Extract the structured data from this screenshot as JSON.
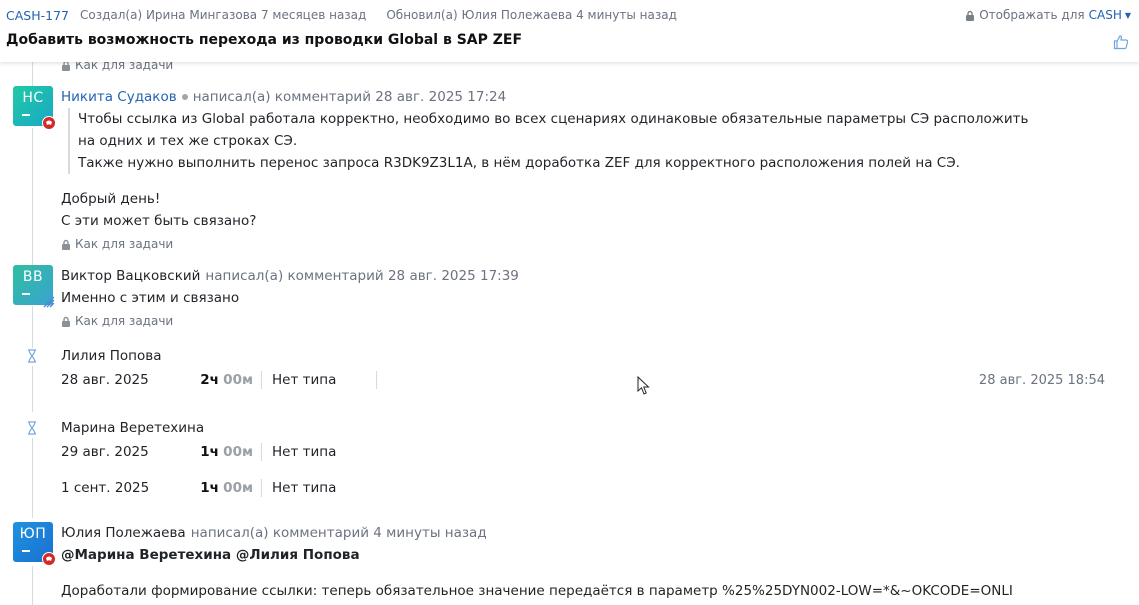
{
  "header": {
    "task_key": "CASH-177",
    "created": "Создал(а) Ирина Мингазова 7 месяцев назад",
    "updated": "Обновил(а) Юлия Полежаева 4 минуты назад",
    "visibility_label": "Отображать для",
    "visibility_project": "CASH",
    "title": "Добавить возможность перехода из проводки Global в SAP ZEF"
  },
  "permission_label": "Как для задачи",
  "comments": [
    {
      "initials": "НС",
      "author": "Никита Судаков",
      "action": "написал(а) комментарий 28 авг. 2025 17:24",
      "quote": [
        "Чтобы ссылка из Global работала корректно, необходимо во всех сценариях одинаковые обязательные параметры СЭ расположить",
        "на одних и тех же строках СЭ.",
        "Также нужно выполнить перенос запроса R3DK9Z3L1A, в нём доработка ZEF для корректного расположения полей на СЭ."
      ],
      "body": [
        "Добрый день!",
        "С эти может быть связано?"
      ]
    },
    {
      "initials": "ВВ",
      "author": "Виктор Вацковский",
      "action": "написал(а) комментарий 28 авг. 2025 17:39",
      "body": [
        "Именно с этим и связано"
      ]
    },
    {
      "initials": "ЮП",
      "author": "Юлия Полежаева",
      "action": "написал(а) комментарий 4 минуты назад",
      "mentions": "@Марина Веретехина @Лилия Попова",
      "body": [
        "Доработали формирование ссылки: теперь обязательное значение передаётся в параметр %25%25DYN002-LOW=*&~OKCODE=ONLI"
      ]
    }
  ],
  "worklogs": [
    {
      "user": "Лилия Попова",
      "entries": [
        {
          "date": "28 авг. 2025",
          "hours": "2ч",
          "minutes": "00м",
          "type": "Нет типа",
          "stamp": "28 авг. 2025 18:54"
        }
      ]
    },
    {
      "user": "Марина Веретехина",
      "entries": [
        {
          "date": "29 авг. 2025",
          "hours": "1ч",
          "minutes": "00м",
          "type": "Нет типа"
        },
        {
          "date": "1 сент. 2025",
          "hours": "1ч",
          "minutes": "00м",
          "type": "Нет типа"
        }
      ]
    }
  ],
  "icons": [
    "lock-icon",
    "like-icon",
    "hourglass-icon",
    "chevron-down-icon",
    "status-badge-icon",
    "mouse-cursor-icon"
  ],
  "colors": {
    "link": "#2563b0",
    "muted": "#6b7280",
    "badge": "#d62828"
  }
}
